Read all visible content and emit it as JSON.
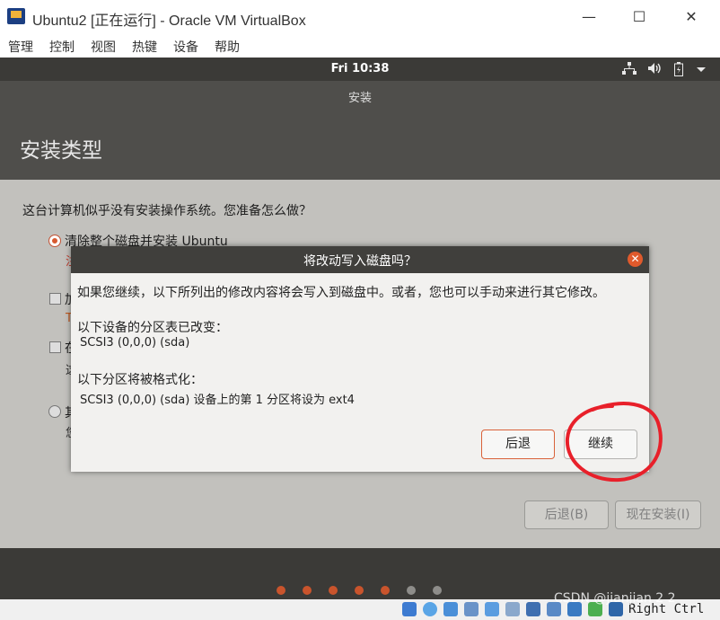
{
  "window": {
    "title": "Ubuntu2 [正在运行] - Oracle VM VirtualBox",
    "minimize": "—",
    "maximize": "☐",
    "close": "✕"
  },
  "menu": [
    "管理",
    "控制",
    "视图",
    "热键",
    "设备",
    "帮助"
  ],
  "panel": {
    "clock": "Fri 10:38",
    "network_icon": "network-icon",
    "volume_icon": "volume-icon",
    "battery_icon": "battery-icon",
    "dropdown_icon": "chevron-down-icon"
  },
  "installer": {
    "caption": "安装",
    "page_title": "安装类型",
    "question": "这台计算机似乎没有安装操作系统。您准备怎么做？",
    "options": [
      {
        "label": "清除整个磁盘并安装 Ubuntu",
        "sub": "注"
      },
      {
        "label": "加",
        "sub": "T"
      },
      {
        "label": "在",
        "sub": "这"
      },
      {
        "label": "其",
        "sub": "您"
      }
    ],
    "back_button": "后退(B)",
    "install_button": "现在安装(I)",
    "accent_color": "#d85a30"
  },
  "dialog": {
    "title": "将改动写入磁盘吗？",
    "message": "如果您继续，以下所列出的修改内容将会写入到磁盘中。或者，您也可以手动来进行其它修改。",
    "partition_table_heading": "以下设备的分区表已改变：",
    "partition_table_device": "SCSI3 (0,0,0) (sda)",
    "format_heading": "以下分区将被格式化：",
    "format_item": "SCSI3 (0,0,0) (sda) 设备上的第 1 分区将设为 ext4",
    "back_button": "后退",
    "continue_button": "继续",
    "close_icon": "close-icon"
  },
  "statusbar": {
    "host_key": "Right Ctrl"
  },
  "watermark": "CSDN @jianjian 2 2"
}
